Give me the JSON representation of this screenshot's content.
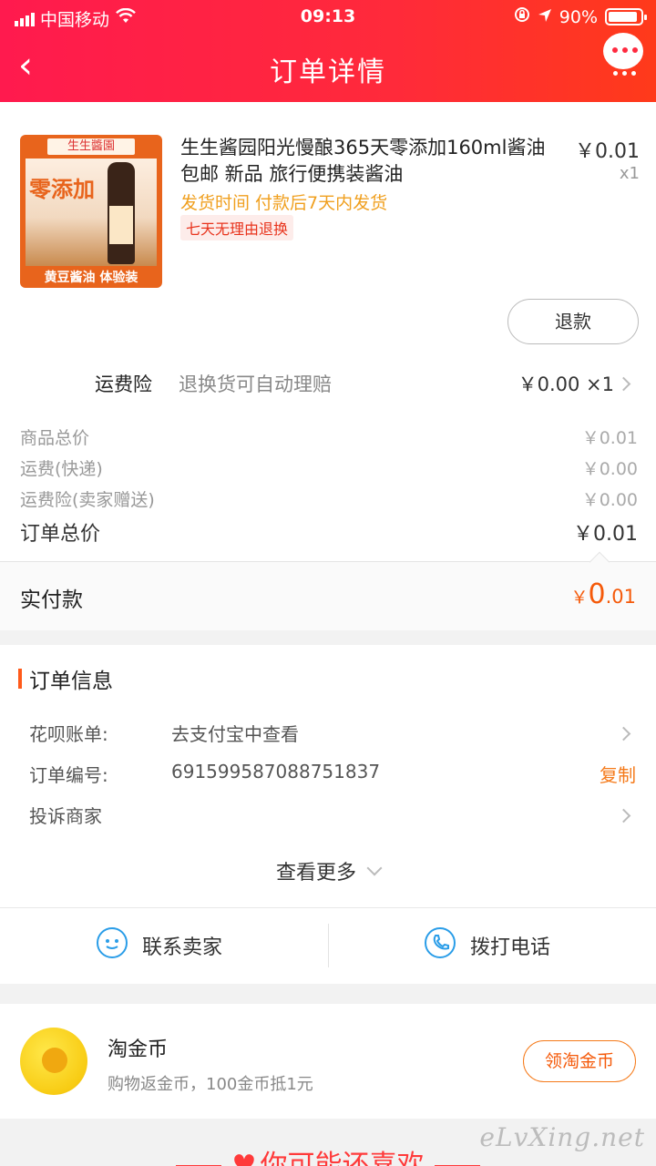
{
  "status": {
    "carrier": "中国移动",
    "time": "09:13",
    "battery": "90%",
    "battery_level": 0.9
  },
  "nav": {
    "back": "‹",
    "title": "订单详情"
  },
  "product": {
    "title": "生生酱园阳光慢酿365天零添加160ml酱油包邮 新品 旅行便携装酱油",
    "price": "￥0.01",
    "qty": "x1",
    "ship_time": "发货时间  付款后7天内发货",
    "tag": "七天无理由退换",
    "thumb_top": "生生醬園",
    "thumb_main": "零添加",
    "thumb_bottom": "黄豆酱油 体验装",
    "refund": "退款"
  },
  "insurance": {
    "label": "运费险",
    "desc": "退换货可自动理赔",
    "price": "￥0.00 ×1"
  },
  "summary": [
    {
      "label": "商品总价",
      "amount": "￥0.01"
    },
    {
      "label": "运费(快递)",
      "amount": "￥0.00"
    },
    {
      "label": "运费险(卖家赠送)",
      "amount": "￥0.00"
    }
  ],
  "total": {
    "label": "订单总价",
    "amount": "￥0.01"
  },
  "paid": {
    "label": "实付款",
    "currency": "￥",
    "int": "0",
    "dec": ".01"
  },
  "order_info": {
    "title": "订单信息",
    "rows": [
      {
        "label": "花呗账单:",
        "value": "去支付宝中查看"
      },
      {
        "label": "订单编号:",
        "value": "691599587088751837",
        "action": "复制"
      },
      {
        "label": "投诉商家",
        "value": ""
      }
    ],
    "more": "查看更多"
  },
  "contact": {
    "seller": "联系卖家",
    "phone": "拨打电话"
  },
  "coins": {
    "title": "淘金币",
    "sub": "购物返金币，100金币抵1元",
    "button": "领淘金币"
  },
  "recommend": {
    "title": "你可能还喜欢"
  },
  "watermark": "eLvXing.net"
}
